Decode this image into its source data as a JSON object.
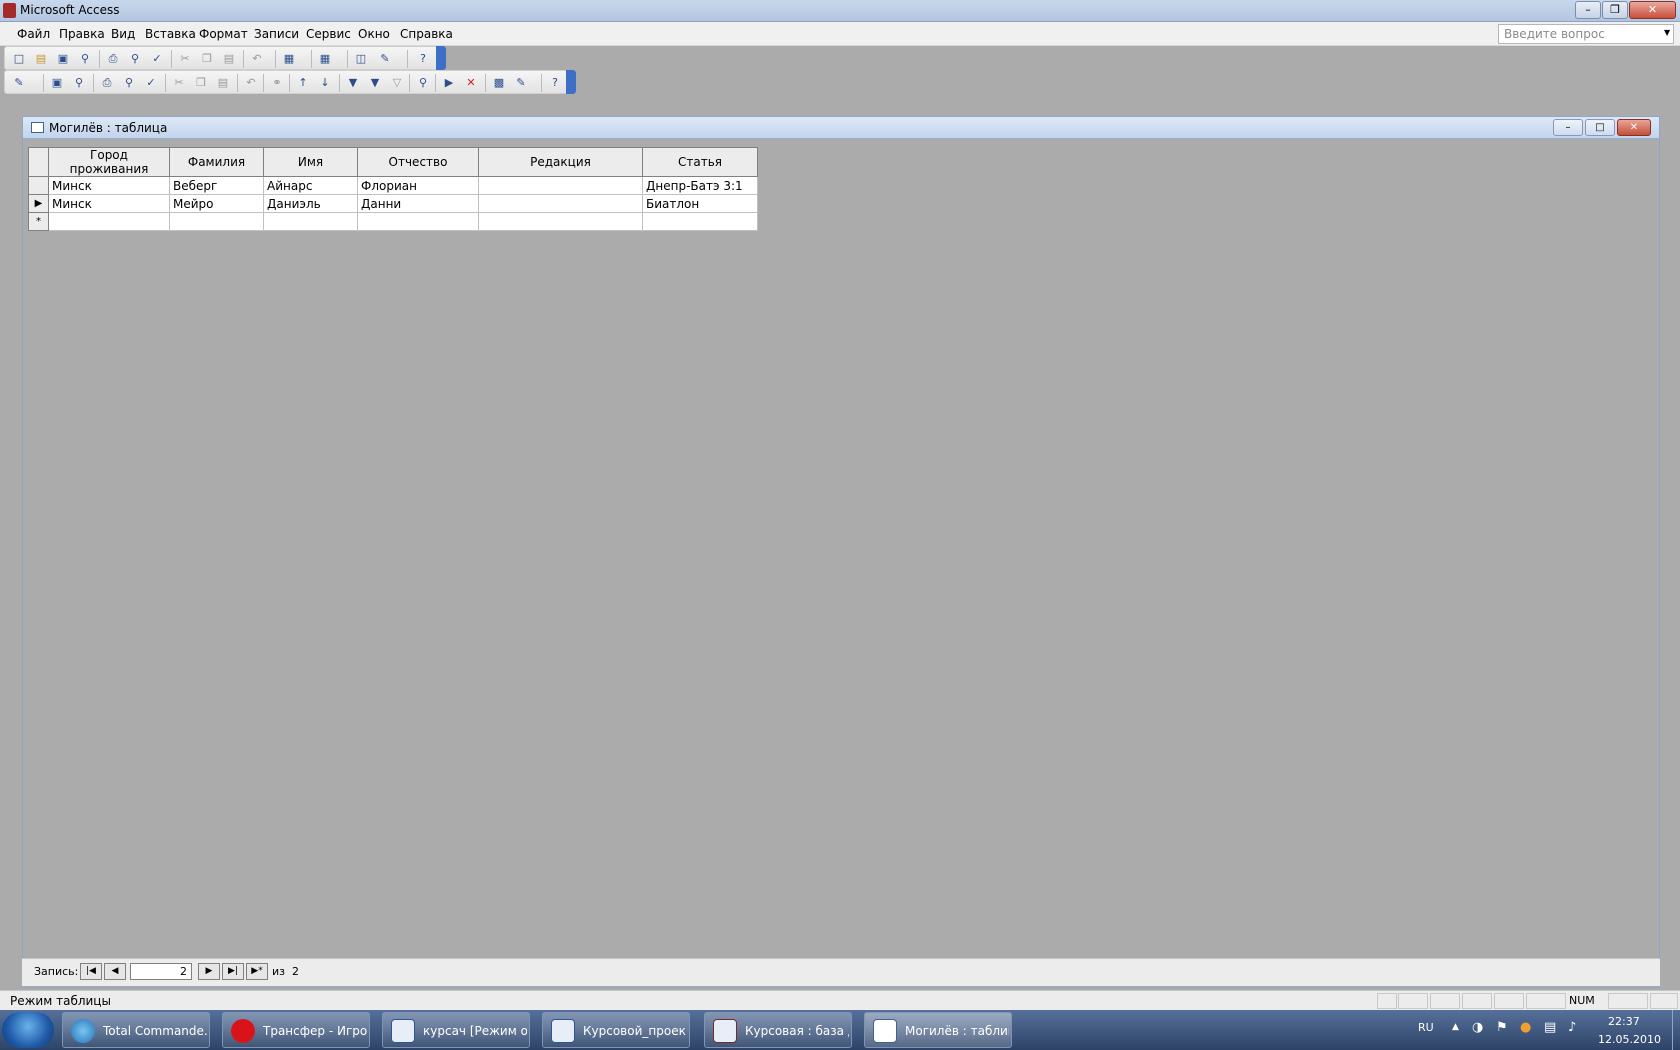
{
  "app": {
    "title": "Microsoft Access"
  },
  "menu": [
    "Файл",
    "Правка",
    "Вид",
    "Вставка",
    "Формат",
    "Записи",
    "Сервис",
    "Окно",
    "Справка"
  ],
  "help": {
    "placeholder": "Введите вопрос"
  },
  "window": {
    "title": "Могилёв : таблица"
  },
  "table": {
    "columns": [
      "Город проживания",
      "Фамилия",
      "Имя",
      "Отчество",
      "Редакция",
      "Статья"
    ],
    "rows": [
      [
        "Минск",
        "Веберг",
        "Айнарс",
        "Флориан",
        "",
        "Днепр-Батэ 3:1"
      ],
      [
        "Минск",
        "Мейро",
        "Даниэль",
        "Данни",
        "",
        "Биатлон"
      ]
    ],
    "current_row_marker": "▶",
    "new_row_marker": "*"
  },
  "record_nav": {
    "label": "Запись:",
    "current": "2",
    "of_label": "из",
    "total": "2"
  },
  "status": {
    "mode": "Режим таблицы",
    "num": "NUM"
  },
  "taskbar": {
    "items": [
      {
        "label": "Total Commande...",
        "icon": "total-commander-icon"
      },
      {
        "label": "Трансфер - Игро...",
        "icon": "opera-icon"
      },
      {
        "label": "курсач [Режим о...",
        "icon": "word-icon"
      },
      {
        "label": "Курсовой_проек...",
        "icon": "word-icon"
      },
      {
        "label": "Курсовая : база д...",
        "icon": "access-icon"
      },
      {
        "label": "Могилёв : таблица",
        "icon": "datasheet-icon"
      }
    ],
    "lang": "RU",
    "time": "22:37",
    "date": "12.05.2010"
  },
  "colors": {
    "accent": "#3e6fc7",
    "mdi_bg": "#ababab",
    "taskbar": "#2d4467"
  }
}
